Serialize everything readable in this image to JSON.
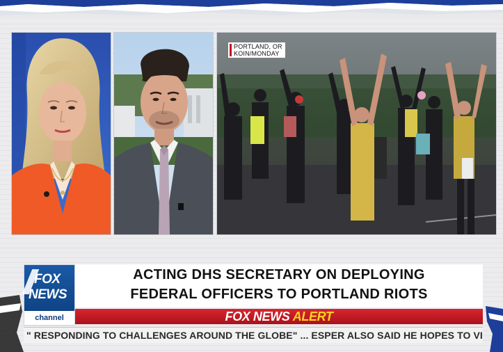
{
  "broadcast": {
    "location_tag_line1": "PORTLAND, OR",
    "location_tag_line2": "KOIN/MONDAY"
  },
  "logo": {
    "top": "FOX",
    "middle": "NEWS",
    "bottom": "channel"
  },
  "lower_third": {
    "headline_line1": "ACTING DHS SECRETARY ON DEPLOYING",
    "headline_line2": "FEDERAL OFFICERS TO PORTLAND RIOTS",
    "alert_brand": "FOX NEWS",
    "alert_word": "ALERT",
    "ticker_text": "\" RESPONDING TO CHALLENGES AROUND THE GLOBE\" ...   ESPER ALSO SAID HE HOPES TO VISIT CHINA THI"
  },
  "colors": {
    "fox_blue": "#0c3d7c",
    "alert_red": "#c1121f",
    "alert_yellow": "#ffd21f",
    "banner_blue": "#1d3f9a"
  }
}
